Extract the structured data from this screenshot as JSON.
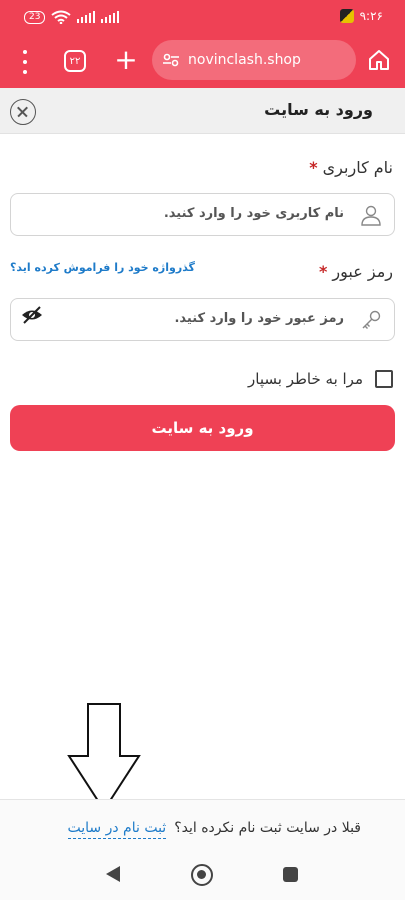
{
  "status_bar": {
    "battery": "23",
    "time": "۹:۲۶",
    "icons": [
      "battery-icon",
      "wifi-icon",
      "signal-icon",
      "signal-icon",
      "app-notification-icon"
    ]
  },
  "browser": {
    "tabs_count": "۲۲",
    "url": "novinclash.shop",
    "icons": [
      "menu-dots-icon",
      "tabs-icon",
      "plus-icon",
      "site-settings-icon",
      "home-icon"
    ]
  },
  "header": {
    "title": "ورود به سایت",
    "icons": [
      "close-icon"
    ]
  },
  "form": {
    "username_label": "نام کاربری",
    "username_placeholder": "نام کاربری خود را وارد کنید.",
    "forgot_link": "گذرواژه خود را فراموش کرده اید؟",
    "password_label": "رمز عبور",
    "password_placeholder": "رمز عبور خود را وارد کنید.",
    "required_mark": "*",
    "remember_label": "مرا به خاطر بسپار",
    "remember_checked": false,
    "submit_label": "ورود به سایت",
    "icons": [
      "user-icon",
      "key-icon",
      "eye-off-icon",
      "checkbox-icon"
    ]
  },
  "footer": {
    "question": "قبلا در سایت ثبت نام نکرده اید؟",
    "register_link": "ثبت نام در سایت",
    "icons": [
      "arrow-down-icon"
    ]
  },
  "nav": {
    "icons": [
      "back-icon",
      "home-circle-icon",
      "recents-icon"
    ]
  },
  "colors": {
    "accent": "#ef4155",
    "link": "#1e7bc9",
    "required": "#c62828"
  }
}
